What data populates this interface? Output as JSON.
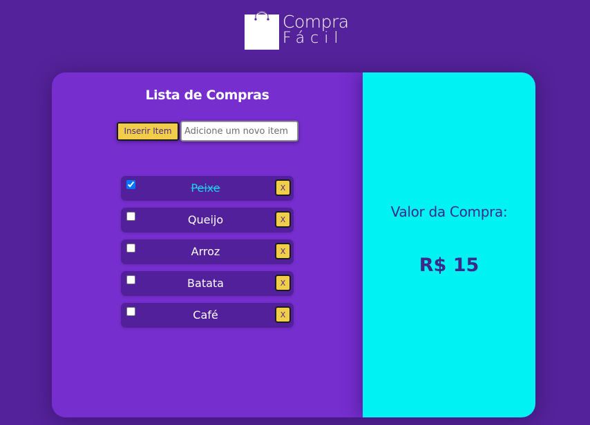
{
  "header": {
    "logo_line1": "Compra",
    "logo_line2": "Fácil",
    "logo_icon": "shopping-bag-icon"
  },
  "list_panel": {
    "title": "Lista de Compras",
    "insert_button_label": "Inserir Item",
    "input_placeholder": "Adicione um novo item",
    "input_value": "",
    "delete_label": "X",
    "items": [
      {
        "label": "Peixe",
        "checked": true
      },
      {
        "label": "Queijo",
        "checked": false
      },
      {
        "label": "Arroz",
        "checked": false
      },
      {
        "label": "Batata",
        "checked": false
      },
      {
        "label": "Café",
        "checked": false
      }
    ]
  },
  "total_panel": {
    "label": "Valor da Compra:",
    "value": "R$ 15"
  },
  "colors": {
    "page_bg": "#54229a",
    "list_panel_bg": "#762ecf",
    "item_bg": "#52209a",
    "total_panel_bg": "#00f2f2",
    "button_yellow": "#f2cd4a",
    "done_text": "#1ed0ea",
    "total_text": "#3b2a8a"
  }
}
